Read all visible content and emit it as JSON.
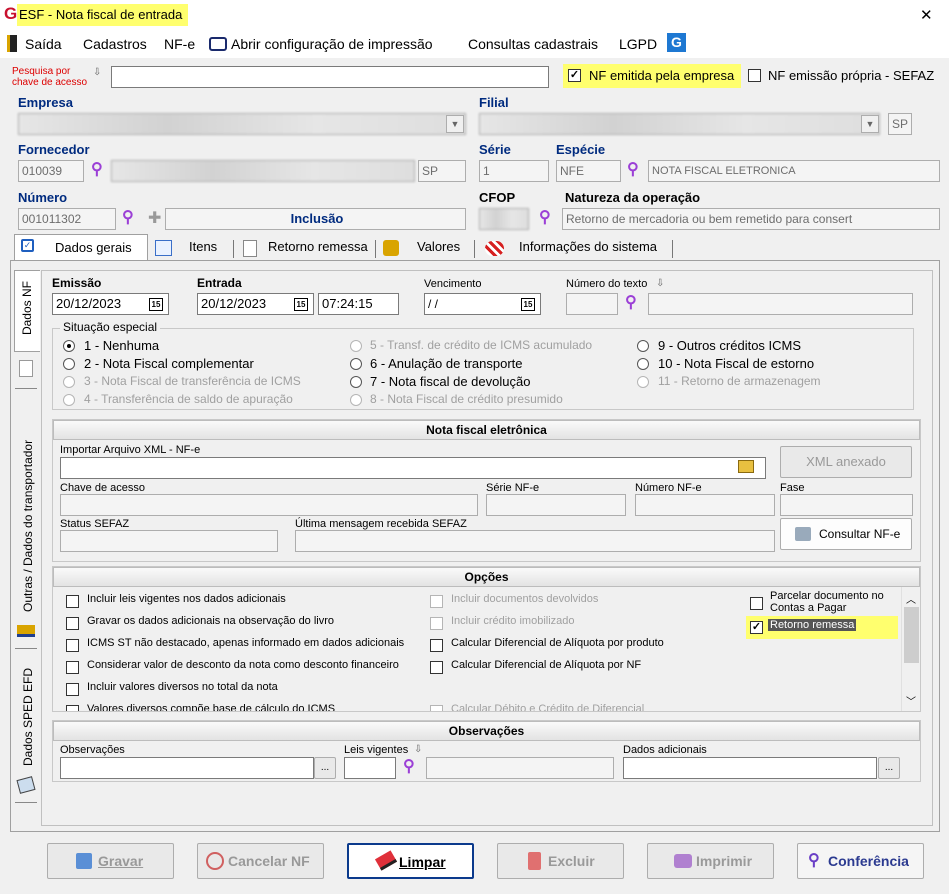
{
  "window": {
    "title": "ESF - Nota fiscal de entrada",
    "close": "✕"
  },
  "menu": {
    "saida": "Saída",
    "cadastros": "Cadastros",
    "nfe": "NF-e",
    "print_config": "Abrir configuração de impressão",
    "consultas": "Consultas cadastrais",
    "lgpd": "LGPD"
  },
  "search_key": {
    "label": "Pesquisa por chave de acesso",
    "value": ""
  },
  "flags": {
    "nf_emitida": "NF emitida pela empresa",
    "nf_emitida_checked": true,
    "nf_propria": "NF emissão própria - SEFAZ",
    "nf_propria_checked": false
  },
  "header": {
    "empresa_label": "Empresa",
    "filial_label": "Filial",
    "filial_uf": "SP",
    "fornecedor_label": "Fornecedor",
    "fornecedor_code": "010039",
    "fornecedor_uf": "SP",
    "serie_label": "Série",
    "serie_value": "1",
    "especie_label": "Espécie",
    "especie_code": "NFE",
    "especie_desc": "NOTA FISCAL ELETRONICA",
    "numero_label": "Número",
    "numero_value": "001011302",
    "mode": "Inclusão",
    "cfop_label": "CFOP",
    "natureza_label": "Natureza da operação",
    "natureza_value": "Retorno de mercadoria ou bem remetido para consert"
  },
  "tabs": [
    {
      "label": "Dados gerais"
    },
    {
      "label": "Itens"
    },
    {
      "label": "Retorno remessa"
    },
    {
      "label": "Valores"
    },
    {
      "label": "Informações do sistema"
    }
  ],
  "side_tabs": {
    "dados_nf": "Dados NF",
    "transportador": "Outras / Dados do transportador",
    "sped": "Dados SPED EFD"
  },
  "dates": {
    "emissao_label": "Emissão",
    "emissao": "20/12/2023",
    "entrada_label": "Entrada",
    "entrada": "20/12/2023",
    "entrada_hora": "07:24:15",
    "vencimento_label": "Vencimento",
    "vencimento": " / /",
    "numero_texto_label": "Número do texto"
  },
  "situacao": {
    "label": "Situação especial",
    "options": [
      {
        "text": "1 - Nenhuma",
        "selected": true,
        "enabled": true
      },
      {
        "text": "2 - Nota Fiscal complementar",
        "selected": false,
        "enabled": true
      },
      {
        "text": "3 - Nota Fiscal de transferência de ICMS",
        "selected": false,
        "enabled": false
      },
      {
        "text": "4 - Transferência de saldo de apuração",
        "selected": false,
        "enabled": false
      },
      {
        "text": "5 - Transf. de crédito de ICMS acumulado",
        "selected": false,
        "enabled": false
      },
      {
        "text": "6 - Anulação de transporte",
        "selected": false,
        "enabled": true
      },
      {
        "text": "7 - Nota fiscal de devolução",
        "selected": false,
        "enabled": true
      },
      {
        "text": "8 - Nota Fiscal de crédito presumido",
        "selected": false,
        "enabled": false
      },
      {
        "text": "9 - Outros créditos ICMS",
        "selected": false,
        "enabled": true
      },
      {
        "text": "10 - Nota Fiscal de estorno",
        "selected": false,
        "enabled": true
      },
      {
        "text": "11 - Retorno de armazenagem",
        "selected": false,
        "enabled": false
      }
    ]
  },
  "nfe": {
    "section": "Nota fiscal eletrônica",
    "import_label": "Importar Arquivo XML - NF-e",
    "xml_btn": "XML anexado",
    "chave_label": "Chave de acesso",
    "serie_label": "Série NF-e",
    "numero_label": "Número NF-e",
    "fase_label": "Fase",
    "status_label": "Status SEFAZ",
    "ultima_label": "Última mensagem recebida SEFAZ",
    "consultar_btn": "Consultar NF-e"
  },
  "opcoes": {
    "section": "Opções",
    "col1": [
      {
        "text": "Incluir leis vigentes nos dados adicionais",
        "checked": false
      },
      {
        "text": "Gravar os dados adicionais na observação do livro",
        "checked": false
      },
      {
        "text": "ICMS ST não destacado, apenas informado em dados adicionais",
        "checked": false
      },
      {
        "text": "Considerar valor de desconto da nota como desconto financeiro",
        "checked": false
      },
      {
        "text": "Incluir valores diversos no total da nota",
        "checked": false
      },
      {
        "text": "Valores diversos compõe base de cálculo do ICMS",
        "checked": false
      }
    ],
    "col2": [
      {
        "text": "Incluir documentos devolvidos",
        "checked": false,
        "enabled": false
      },
      {
        "text": "Incluir crédito imobilizado",
        "checked": false,
        "enabled": false
      },
      {
        "text": "Calcular Diferencial de Alíquota por produto",
        "checked": false,
        "enabled": true
      },
      {
        "text": "Calcular Diferencial de Alíquota por NF",
        "checked": false,
        "enabled": true
      },
      {
        "text": "Calcular Débito e Crédito de Diferencial",
        "checked": false,
        "enabled": false
      }
    ],
    "col3": [
      {
        "text": "Parcelar documento no Contas a Pagar",
        "checked": false
      },
      {
        "text": "Retorno remessa",
        "checked": true
      }
    ]
  },
  "observacoes": {
    "section": "Observações",
    "obs_label": "Observações",
    "leis_label": "Leis vigentes",
    "dados_label": "Dados adicionais",
    "ellipsis": "..."
  },
  "buttons": {
    "gravar": "Gravar",
    "cancelar": "Cancelar NF",
    "limpar": "Limpar",
    "excluir": "Excluir",
    "imprimir": "Imprimir",
    "conferencia": "Conferência"
  },
  "colors": {
    "highlight": "#ffff6e",
    "header_blue": "#002b7f",
    "search_purple": "#9b3fd6",
    "red_label": "#dd0000"
  }
}
